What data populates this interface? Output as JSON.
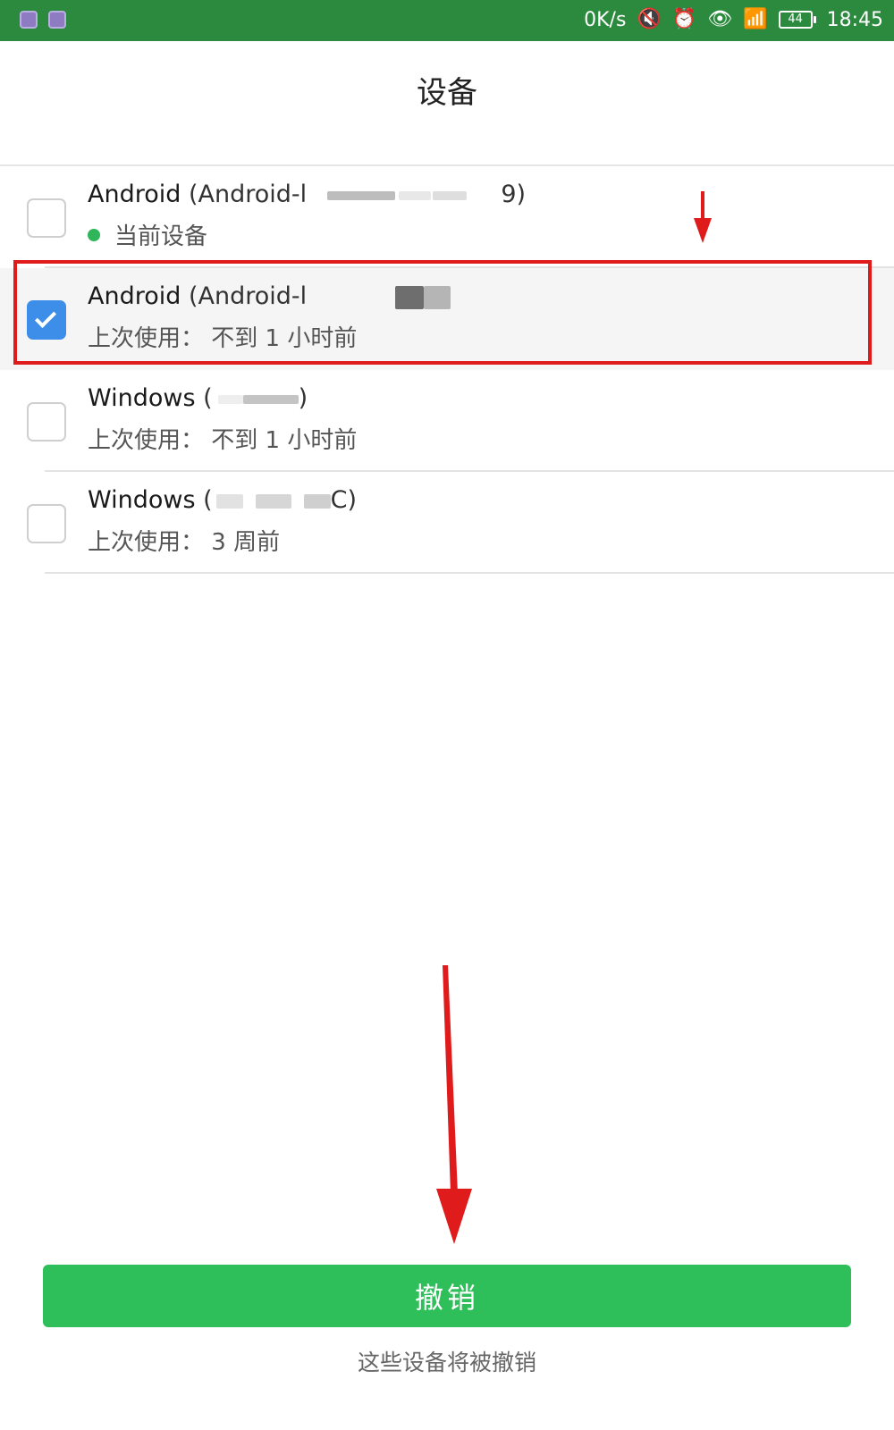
{
  "status_bar": {
    "speed": "0K/s",
    "battery": "44",
    "time": "18:45"
  },
  "header": {
    "title": "设备"
  },
  "devices": [
    {
      "name": "Android",
      "detail_prefix": "(Android-l",
      "detail_suffix": "9)",
      "subtitle": "当前设备",
      "checked": false
    },
    {
      "name": "Android",
      "detail_prefix": "(Android-l",
      "detail_suffix": "",
      "subtitle": "上次使用：  不到 1 小时前",
      "checked": true
    },
    {
      "name": "Windows",
      "detail_prefix": "(",
      "detail_suffix": ")",
      "subtitle": "上次使用：  不到 1 小时前",
      "checked": false
    },
    {
      "name": "Windows",
      "detail_prefix": "(",
      "detail_suffix": "C)",
      "subtitle": "上次使用：  3 周前",
      "checked": false
    }
  ],
  "actions": {
    "revoke_label": "撤销",
    "revoke_note": "这些设备将被撤销"
  },
  "colors": {
    "status_bar": "#2b8a3e",
    "accent_green": "#2fbf5a",
    "checkbox_blue": "#3d8ee8",
    "annotation_red": "#e01b1b"
  }
}
